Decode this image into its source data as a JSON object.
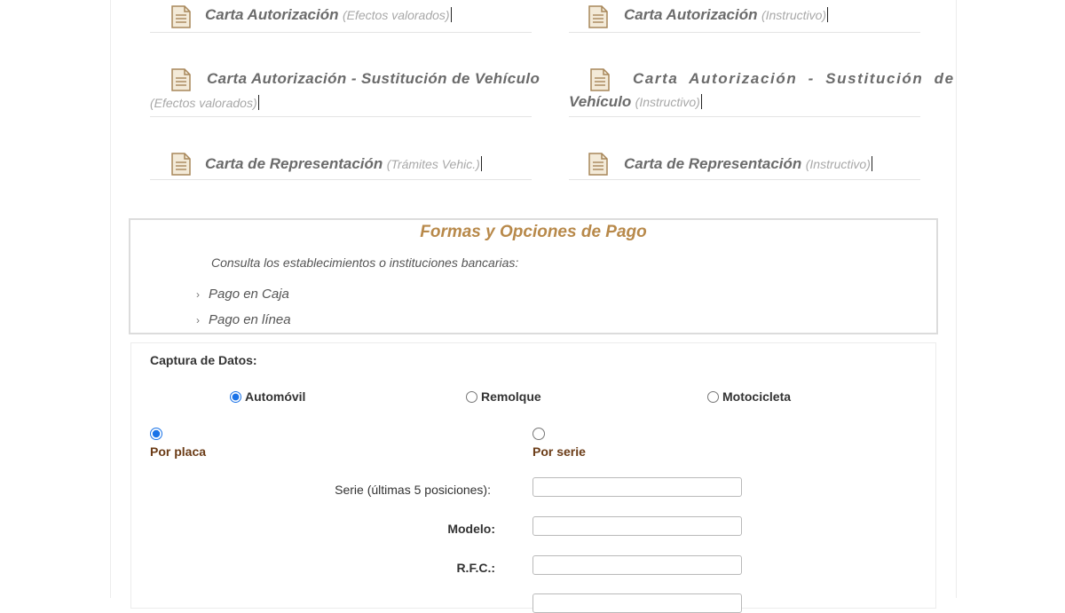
{
  "documents": [
    {
      "title": "Carta Autorización",
      "sub": "(Efectos valorados)"
    },
    {
      "title": "Carta Autorización",
      "sub": "(Instructivo)"
    },
    {
      "title": "Carta Autorización - Sustitución de Vehículo",
      "sub": "(Efectos valorados)"
    },
    {
      "title_line1": "Carta Autorización - Sustitución de",
      "title_line2": "Vehículo",
      "sub": "(Instructivo)"
    },
    {
      "title": "Carta de Representación",
      "sub": "(Trámites Vehic.)"
    },
    {
      "title": "Carta de Representación",
      "sub": "(Instructivo)"
    }
  ],
  "pago": {
    "title": "Formas y Opciones de Pago",
    "intro": "Consulta los establecimientos o instituciones bancarias:",
    "links": [
      "Pago en Caja",
      "Pago en línea"
    ]
  },
  "captura": {
    "title": "Captura de Datos:",
    "vehicle_types": [
      {
        "label": "Automóvil",
        "checked": true
      },
      {
        "label": "Remolque",
        "checked": false
      },
      {
        "label": "Motocicleta",
        "checked": false
      }
    ],
    "modes": [
      {
        "label": "Por placa",
        "checked": true
      },
      {
        "label": "Por serie",
        "checked": false
      }
    ],
    "fields": [
      {
        "label": "Serie (últimas 5 posiciones):",
        "value": ""
      },
      {
        "label": "Modelo:",
        "value": ""
      },
      {
        "label": "R.F.C.:",
        "value": ""
      }
    ]
  },
  "colors": {
    "accent_gold": "#b8894a",
    "mode_label": "#6b3c17",
    "radio": "#1a73e8"
  },
  "icons": {
    "document": "document-icon",
    "chevron": "chevron-right-icon"
  }
}
